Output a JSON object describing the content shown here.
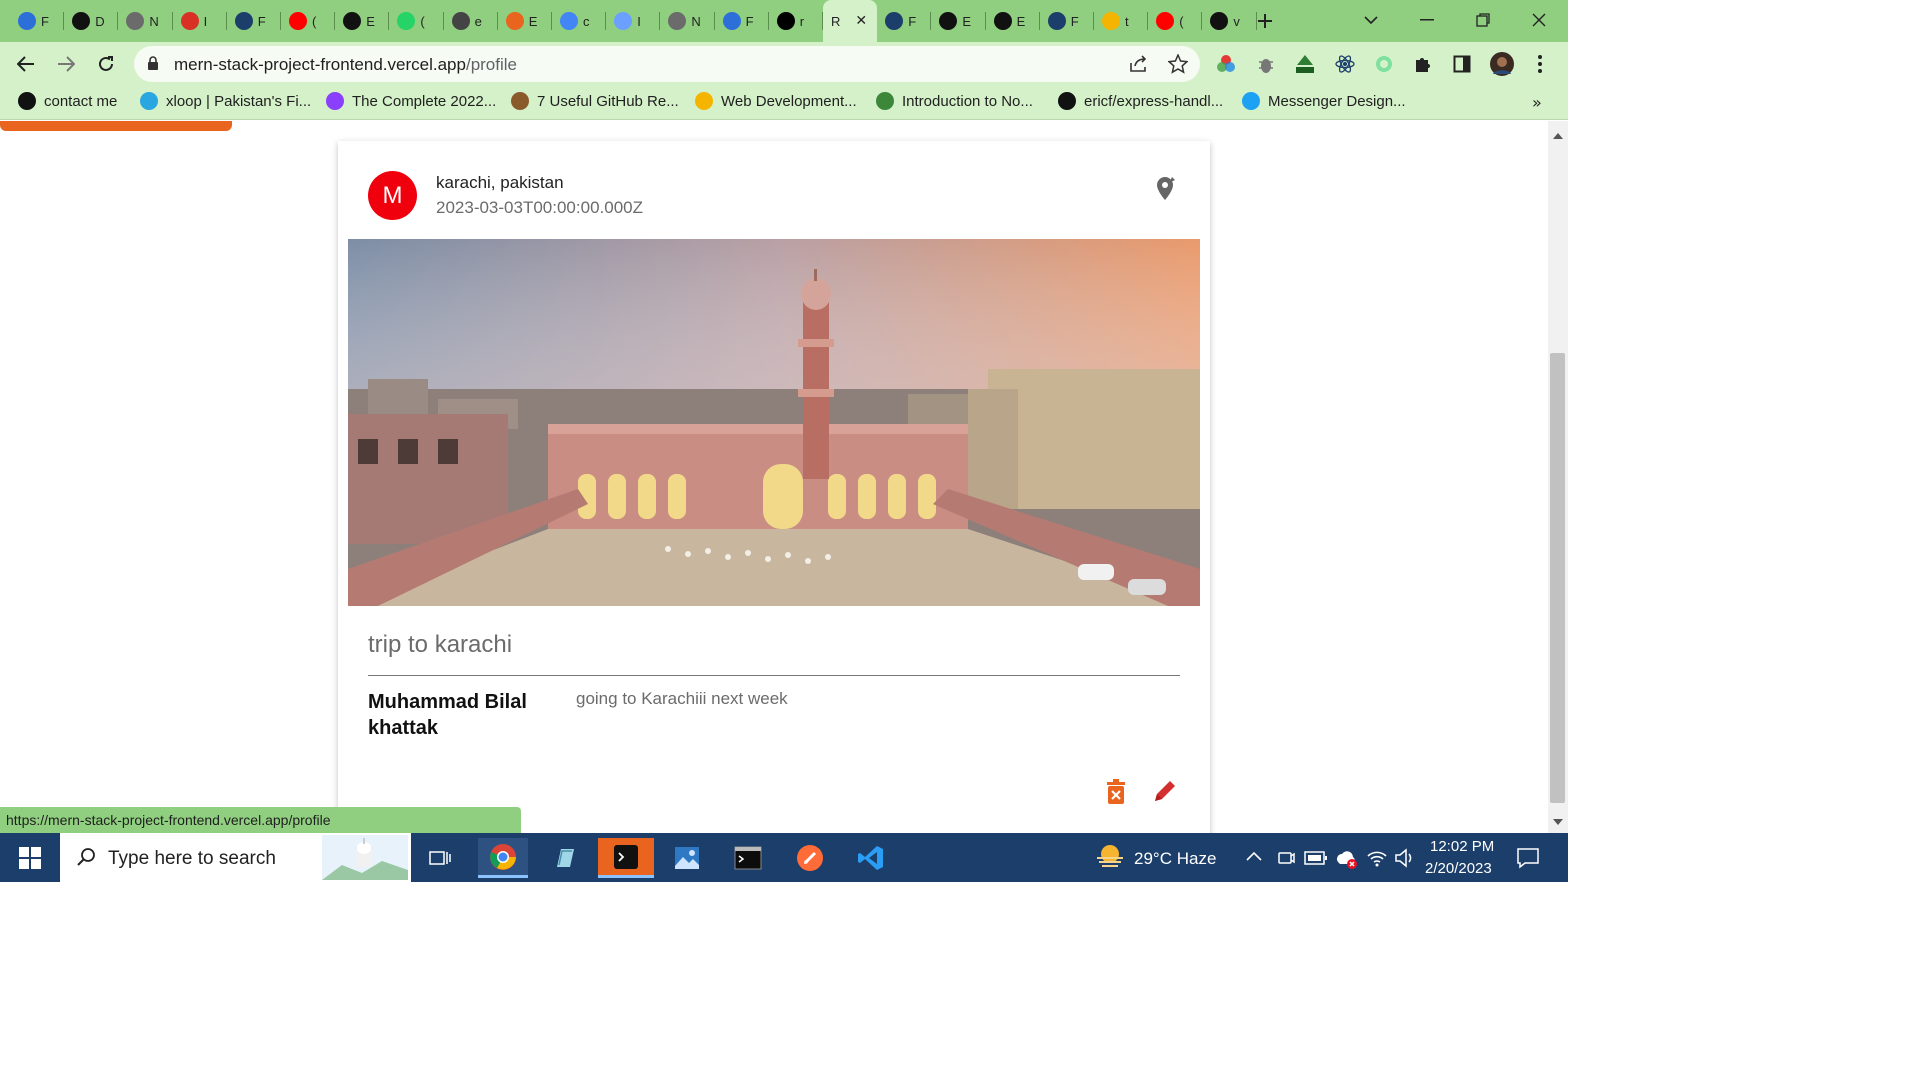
{
  "browser": {
    "tabs": [
      {
        "label": "F",
        "icon": "mural-icon",
        "color": "#2d6fd8"
      },
      {
        "label": "D",
        "icon": "mongodb-icon",
        "color": "#111111"
      },
      {
        "label": "N",
        "icon": "openai-icon",
        "color": "#6b6b6b"
      },
      {
        "label": "I",
        "icon": "gmail-icon",
        "color": "#d93025"
      },
      {
        "label": "F",
        "icon": "react-icon",
        "color": "#1b3e6a"
      },
      {
        "label": "(",
        "icon": "youtube-icon",
        "color": "#ff0000"
      },
      {
        "label": "E",
        "icon": "github-icon",
        "color": "#111111"
      },
      {
        "label": "(",
        "icon": "whatsapp-icon",
        "color": "#25d366"
      },
      {
        "label": "e",
        "icon": "app-icon",
        "color": "#444444"
      },
      {
        "label": "E",
        "icon": "frame-icon",
        "color": "#e8641f"
      },
      {
        "label": "c",
        "icon": "google-icon",
        "color": "#4285f4"
      },
      {
        "label": "I",
        "icon": "flag-icon",
        "color": "#6ba0ff"
      },
      {
        "label": "N",
        "icon": "openai-icon",
        "color": "#6b6b6b"
      },
      {
        "label": "F",
        "icon": "c-icon",
        "color": "#2d6fd8"
      },
      {
        "label": "r",
        "icon": "vercel-icon",
        "color": "#000000"
      },
      {
        "label": "R",
        "icon": "",
        "color": "",
        "active": true
      },
      {
        "label": "F",
        "icon": "react-icon",
        "color": "#1b3e6a"
      },
      {
        "label": "E",
        "icon": "globe-icon",
        "color": "#111111"
      },
      {
        "label": "E",
        "icon": "globe-icon",
        "color": "#111111"
      },
      {
        "label": "F",
        "icon": "react-icon",
        "color": "#1b3e6a"
      },
      {
        "label": "t",
        "icon": "drive-icon",
        "color": "#f4b400"
      },
      {
        "label": "(",
        "icon": "youtube-icon",
        "color": "#ff0000"
      },
      {
        "label": "v",
        "icon": "github-icon",
        "color": "#111111"
      }
    ],
    "url_host": "mern-stack-project-frontend.vercel.app",
    "url_path": "/profile",
    "bookmarks": [
      {
        "label": "contact me",
        "color": "#111111"
      },
      {
        "label": "xloop | Pakistan's Fi...",
        "color": "#2aa7e0"
      },
      {
        "label": "The Complete 2022...",
        "color": "#8a3ffc"
      },
      {
        "label": "7 Useful GitHub Re...",
        "color": "#8b5a2b"
      },
      {
        "label": "Web Development...",
        "color": "#f4b400"
      },
      {
        "label": "Introduction to No...",
        "color": "#3c873a"
      },
      {
        "label": "ericf/express-handl...",
        "color": "#111111"
      },
      {
        "label": "Messenger Design...",
        "color": "#1da1f2"
      }
    ],
    "status_url": "https://mern-stack-project-frontend.vercel.app/profile"
  },
  "post": {
    "avatar_letter": "M",
    "location": "karachi, pakistan",
    "date": "2023-03-03T00:00:00.000Z",
    "title": "trip to karachi",
    "author": "Muhammad Bilal khattak",
    "description": "going to Karachiii next week",
    "accent_color": "#f0000c"
  },
  "taskbar": {
    "search_placeholder": "Type here to search",
    "weather": "29°C  Haze",
    "time": "12:02 PM",
    "date": "2/20/2023"
  }
}
